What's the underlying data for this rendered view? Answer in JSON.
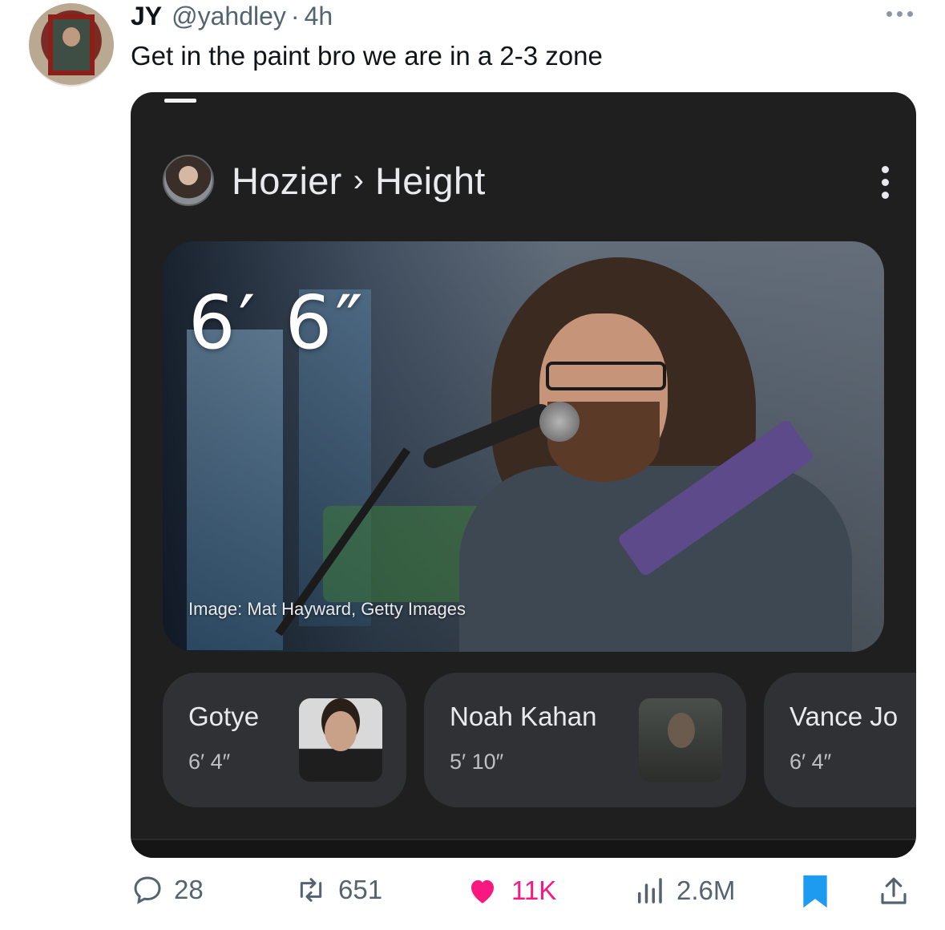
{
  "tweet": {
    "author_name": "JY",
    "handle": "@yahdley",
    "separator": "·",
    "time": "4h",
    "text": "Get in the paint bro we are in a 2-3 zone"
  },
  "card": {
    "breadcrumb": {
      "entity": "Hozier",
      "separator": "›",
      "attribute": "Height"
    },
    "hero": {
      "value": "6′ 6″",
      "credit": "Image: Mat Hayward, Getty Images"
    },
    "related": [
      {
        "name": "Gotye",
        "height": "6′ 4″"
      },
      {
        "name": "Noah Kahan",
        "height": "5′ 10″"
      },
      {
        "name": "Vance Jo",
        "height": "6′ 4″"
      }
    ]
  },
  "metrics": {
    "replies": "28",
    "retweets": "651",
    "likes": "11K",
    "views": "2.6M"
  },
  "colors": {
    "like": "#f91880",
    "bookmark": "#1d9bf0",
    "card_bg": "#1f1f1f",
    "muted": "#536471"
  }
}
